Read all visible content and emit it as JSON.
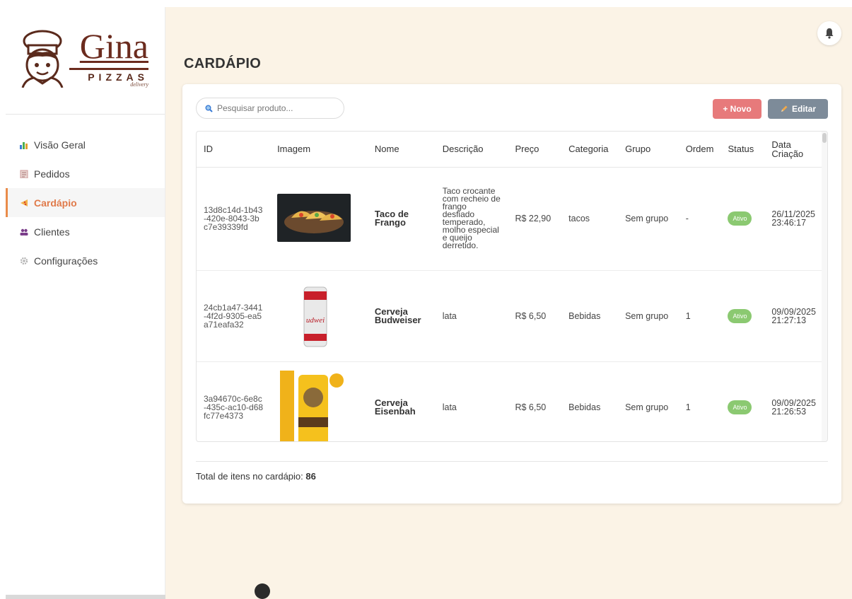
{
  "brand": {
    "name": "Gina",
    "sub": "PIZZAS",
    "tagline": "delivery"
  },
  "sidebar": {
    "items": [
      {
        "label": "Visão Geral",
        "icon": "chart-icon"
      },
      {
        "label": "Pedidos",
        "icon": "clipboard-icon"
      },
      {
        "label": "Cardápio",
        "icon": "pizza-icon",
        "active": true
      },
      {
        "label": "Clientes",
        "icon": "users-icon"
      },
      {
        "label": "Configurações",
        "icon": "gear-icon"
      }
    ]
  },
  "header": {
    "title": "CARDÁPIO",
    "notification_icon": "bell-icon"
  },
  "toolbar": {
    "search_placeholder": "Pesquisar produto...",
    "new_label": "+ Novo",
    "edit_label": "Editar"
  },
  "table": {
    "columns": [
      "ID",
      "Imagem",
      "Nome",
      "Descrição",
      "Preço",
      "Categoria",
      "Grupo",
      "Ordem",
      "Status",
      "Data Criação"
    ],
    "rows": [
      {
        "id": "13d8c14d-1b43-420e-8043-3bc7e39339fd",
        "image": "taco-photo",
        "nome": "Taco de Frango",
        "descricao": "Taco crocante com recheio de frango desfiado temperado, molho especial e queijo derretido.",
        "preco": "R$ 22,90",
        "categoria": "tacos",
        "grupo": "Sem grupo",
        "ordem": "-",
        "status": "Ativo",
        "data": "26/11/2025 23:46:17"
      },
      {
        "id": "24cb1a47-3441-4f2d-9305-ea5a71eafa32",
        "image": "budweiser-can-photo",
        "nome": "Cerveja Budweiser",
        "descricao": "lata",
        "preco": "R$ 6,50",
        "categoria": "Bebidas",
        "grupo": "Sem grupo",
        "ordem": "1",
        "status": "Ativo",
        "data": "09/09/2025 21:27:13"
      },
      {
        "id": "3a94670c-6e8c-435c-ac10-d68fc77e4373",
        "image": "eisenbahn-can-photo",
        "nome": "Cerveja Eisenbah",
        "descricao": "lata",
        "preco": "R$ 6,50",
        "categoria": "Bebidas",
        "grupo": "Sem grupo",
        "ordem": "1",
        "status": "Ativo",
        "data": "09/09/2025 21:26:53"
      }
    ]
  },
  "footer": {
    "total_label": "Total de itens no cardápio:",
    "total_value": "86"
  },
  "colors": {
    "accent": "#e07a4a",
    "background": "#fbf3e6",
    "new_button": "#e77a7b",
    "edit_button": "#7d8b99",
    "status_active": "#8bc971"
  }
}
